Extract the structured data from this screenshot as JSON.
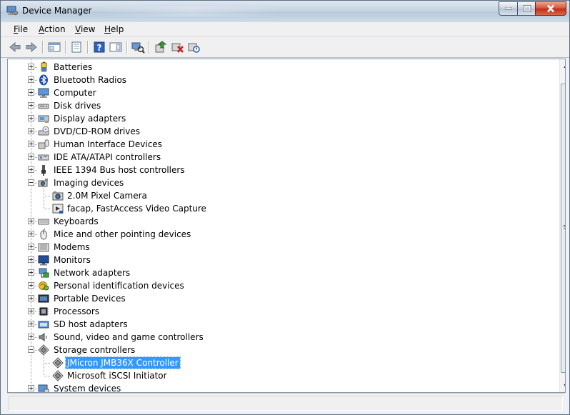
{
  "window": {
    "title": "Device Manager"
  },
  "menu": [
    {
      "key": "F",
      "rest": "ile"
    },
    {
      "key": "A",
      "rest": "ction"
    },
    {
      "key": "V",
      "rest": "iew"
    },
    {
      "key": "H",
      "rest": "elp"
    }
  ],
  "toolbar": {
    "buttons": [
      "back-icon",
      "forward-icon",
      "show-hide-tree-icon",
      "properties-icon",
      "help-icon",
      "show-details-icon",
      "scan-hardware-icon",
      "update-driver-icon",
      "uninstall-icon",
      "disable-icon"
    ]
  },
  "tree": {
    "selected": "JMicron JMB36X Controller",
    "items": [
      {
        "label": "Batteries",
        "level": 0,
        "expanded": false,
        "icon": "battery-icon"
      },
      {
        "label": "Bluetooth Radios",
        "level": 0,
        "expanded": false,
        "icon": "bluetooth-icon"
      },
      {
        "label": "Computer",
        "level": 0,
        "expanded": false,
        "icon": "computer-icon"
      },
      {
        "label": "Disk drives",
        "level": 0,
        "expanded": false,
        "icon": "disk-drive-icon"
      },
      {
        "label": "Display adapters",
        "level": 0,
        "expanded": false,
        "icon": "display-adapter-icon"
      },
      {
        "label": "DVD/CD-ROM drives",
        "level": 0,
        "expanded": false,
        "icon": "dvd-drive-icon"
      },
      {
        "label": "Human Interface Devices",
        "level": 0,
        "expanded": false,
        "icon": "hid-icon"
      },
      {
        "label": "IDE ATA/ATAPI controllers",
        "level": 0,
        "expanded": false,
        "icon": "ide-controller-icon"
      },
      {
        "label": "IEEE 1394 Bus host controllers",
        "level": 0,
        "expanded": false,
        "icon": "firewire-icon"
      },
      {
        "label": "Imaging devices",
        "level": 0,
        "expanded": true,
        "icon": "camera-icon"
      },
      {
        "label": "2.0M Pixel Camera",
        "level": 1,
        "icon": "camera-device-icon"
      },
      {
        "label": "facap, FastAccess Video Capture",
        "level": 1,
        "icon": "video-capture-icon"
      },
      {
        "label": "Keyboards",
        "level": 0,
        "expanded": false,
        "icon": "keyboard-icon"
      },
      {
        "label": "Mice and other pointing devices",
        "level": 0,
        "expanded": false,
        "icon": "mouse-icon"
      },
      {
        "label": "Modems",
        "level": 0,
        "expanded": false,
        "icon": "modem-icon"
      },
      {
        "label": "Monitors",
        "level": 0,
        "expanded": false,
        "icon": "monitor-icon"
      },
      {
        "label": "Network adapters",
        "level": 0,
        "expanded": false,
        "icon": "network-adapter-icon"
      },
      {
        "label": "Personal identification devices",
        "level": 0,
        "expanded": false,
        "icon": "fingerprint-icon"
      },
      {
        "label": "Portable Devices",
        "level": 0,
        "expanded": false,
        "icon": "portable-device-icon"
      },
      {
        "label": "Processors",
        "level": 0,
        "expanded": false,
        "icon": "processor-icon"
      },
      {
        "label": "SD host adapters",
        "level": 0,
        "expanded": false,
        "icon": "sd-card-icon"
      },
      {
        "label": "Sound, video and game controllers",
        "level": 0,
        "expanded": false,
        "icon": "speaker-icon"
      },
      {
        "label": "Storage controllers",
        "level": 0,
        "expanded": true,
        "icon": "storage-controller-icon"
      },
      {
        "label": "JMicron JMB36X Controller",
        "level": 1,
        "icon": "storage-controller-icon"
      },
      {
        "label": "Microsoft iSCSI Initiator",
        "level": 1,
        "icon": "storage-controller-icon"
      },
      {
        "label": "System devices",
        "level": 0,
        "expanded": false,
        "icon": "system-device-icon"
      }
    ]
  },
  "status": {
    "text": ""
  },
  "colors": {
    "selection": "#3399ff",
    "titlebar": "#c7d5e3"
  }
}
